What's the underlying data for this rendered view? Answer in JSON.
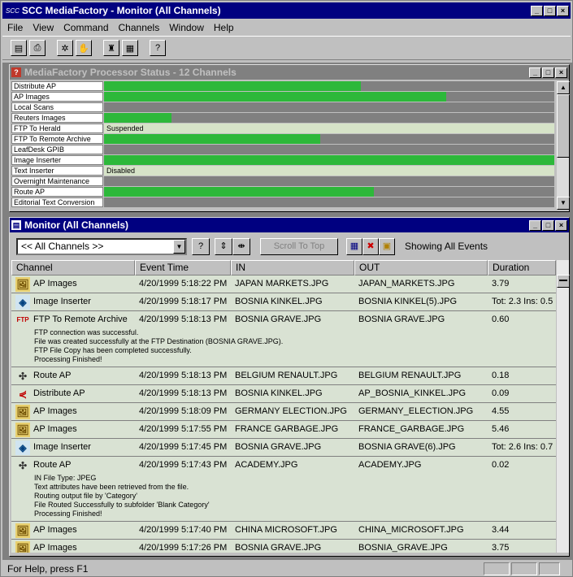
{
  "app": {
    "icon_text": "SCC",
    "title": "SCC MediaFactory - Monitor (All Channels)"
  },
  "menu": [
    "File",
    "View",
    "Command",
    "Channels",
    "Window",
    "Help"
  ],
  "status_window": {
    "title": "MediaFactory Processor Status - 12 Channels",
    "channels": [
      {
        "name": "Distribute AP",
        "fill": 0.57,
        "text": ""
      },
      {
        "name": "AP Images",
        "fill": 0.76,
        "text": ""
      },
      {
        "name": "Local Scans",
        "fill": 0,
        "text": ""
      },
      {
        "name": "Reuters Images",
        "fill": 0.15,
        "text": ""
      },
      {
        "name": "FTP To Herald",
        "fill": 0,
        "text": "Suspended",
        "light": true
      },
      {
        "name": "FTP To Remote Archive",
        "fill": 0.48,
        "text": ""
      },
      {
        "name": "LeafDesk GPIB",
        "fill": 0,
        "text": ""
      },
      {
        "name": "Image Inserter",
        "fill": 1.0,
        "text": ""
      },
      {
        "name": "Text Inserter",
        "fill": 0,
        "text": "Disabled",
        "light": true
      },
      {
        "name": "Overnight Maintenance",
        "fill": 0,
        "text": ""
      },
      {
        "name": "Route AP",
        "fill": 0.6,
        "text": ""
      },
      {
        "name": "Editorial Text Conversion",
        "fill": 0,
        "text": ""
      }
    ]
  },
  "monitor": {
    "title": "Monitor (All Channels)",
    "filter": "<< All Channels >>",
    "scroll_to_top": "Scroll To Top",
    "showing": "Showing All Events",
    "columns": [
      "Channel",
      "Event Time",
      "IN",
      "OUT",
      "Duration"
    ],
    "rows": [
      {
        "icon": "images",
        "channel": "AP Images",
        "time": "4/20/1999 5:18:22 PM",
        "in": "JAPAN MARKETS.JPG",
        "out": "JAPAN_MARKETS.JPG",
        "duration": "3.79"
      },
      {
        "icon": "inserter",
        "channel": "Image Inserter",
        "time": "4/20/1999 5:18:17 PM",
        "in": "BOSNIA KINKEL.JPG",
        "out": "BOSNIA KINKEL(5).JPG",
        "duration": "Tot: 2.3  Ins: 0.5"
      },
      {
        "icon": "ftp",
        "channel": "FTP To Remote Archive",
        "time": "4/20/1999 5:18:13 PM",
        "in": "BOSNIA GRAVE.JPG",
        "out": "BOSNIA GRAVE.JPG",
        "duration": "0.60",
        "details": [
          "FTP connection was successful.",
          "File was created successfully at the FTP Destination (BOSNIA GRAVE.JPG).",
          "FTP File Copy has been completed successfully.",
          "Processing Finished!"
        ]
      },
      {
        "icon": "route",
        "channel": "Route AP",
        "time": "4/20/1999 5:18:13 PM",
        "in": "BELGIUM RENAULT.JPG",
        "out": "BELGIUM RENAULT.JPG",
        "duration": "0.18"
      },
      {
        "icon": "distribute",
        "channel": "Distribute AP",
        "time": "4/20/1999 5:18:13 PM",
        "in": "BOSNIA KINKEL.JPG",
        "out": "AP_BOSNIA_KINKEL.JPG",
        "duration": "0.09"
      },
      {
        "icon": "images",
        "channel": "AP Images",
        "time": "4/20/1999 5:18:09 PM",
        "in": "GERMANY ELECTION.JPG",
        "out": "GERMANY_ELECTION.JPG",
        "duration": "4.55"
      },
      {
        "icon": "images",
        "channel": "AP Images",
        "time": "4/20/1999 5:17:55 PM",
        "in": "FRANCE GARBAGE.JPG",
        "out": "FRANCE_GARBAGE.JPG",
        "duration": "5.46"
      },
      {
        "icon": "inserter",
        "channel": "Image Inserter",
        "time": "4/20/1999 5:17:45 PM",
        "in": "BOSNIA GRAVE.JPG",
        "out": "BOSNIA GRAVE(6).JPG",
        "duration": "Tot: 2.6  Ins: 0.7"
      },
      {
        "icon": "route",
        "channel": "Route AP",
        "time": "4/20/1999 5:17:43 PM",
        "in": "ACADEMY.JPG",
        "out": "ACADEMY.JPG",
        "duration": "0.02",
        "details": [
          "IN File Type: JPEG",
          "Text attributes have been retrieved from the file.",
          "Routing output file by 'Category'",
          "File Routed Successfully to subfolder 'Blank Category'",
          "Processing Finished!"
        ]
      },
      {
        "icon": "images",
        "channel": "AP Images",
        "time": "4/20/1999 5:17:40 PM",
        "in": "CHINA MICROSOFT.JPG",
        "out": "CHINA_MICROSOFT.JPG",
        "duration": "3.44"
      },
      {
        "icon": "images",
        "channel": "AP Images",
        "time": "4/20/1999 5:17:26 PM",
        "in": "BOSNIA GRAVE.JPG",
        "out": "BOSNIA_GRAVE.JPG",
        "duration": "3.75"
      }
    ]
  },
  "statusbar": {
    "text": "For Help, press F1"
  }
}
